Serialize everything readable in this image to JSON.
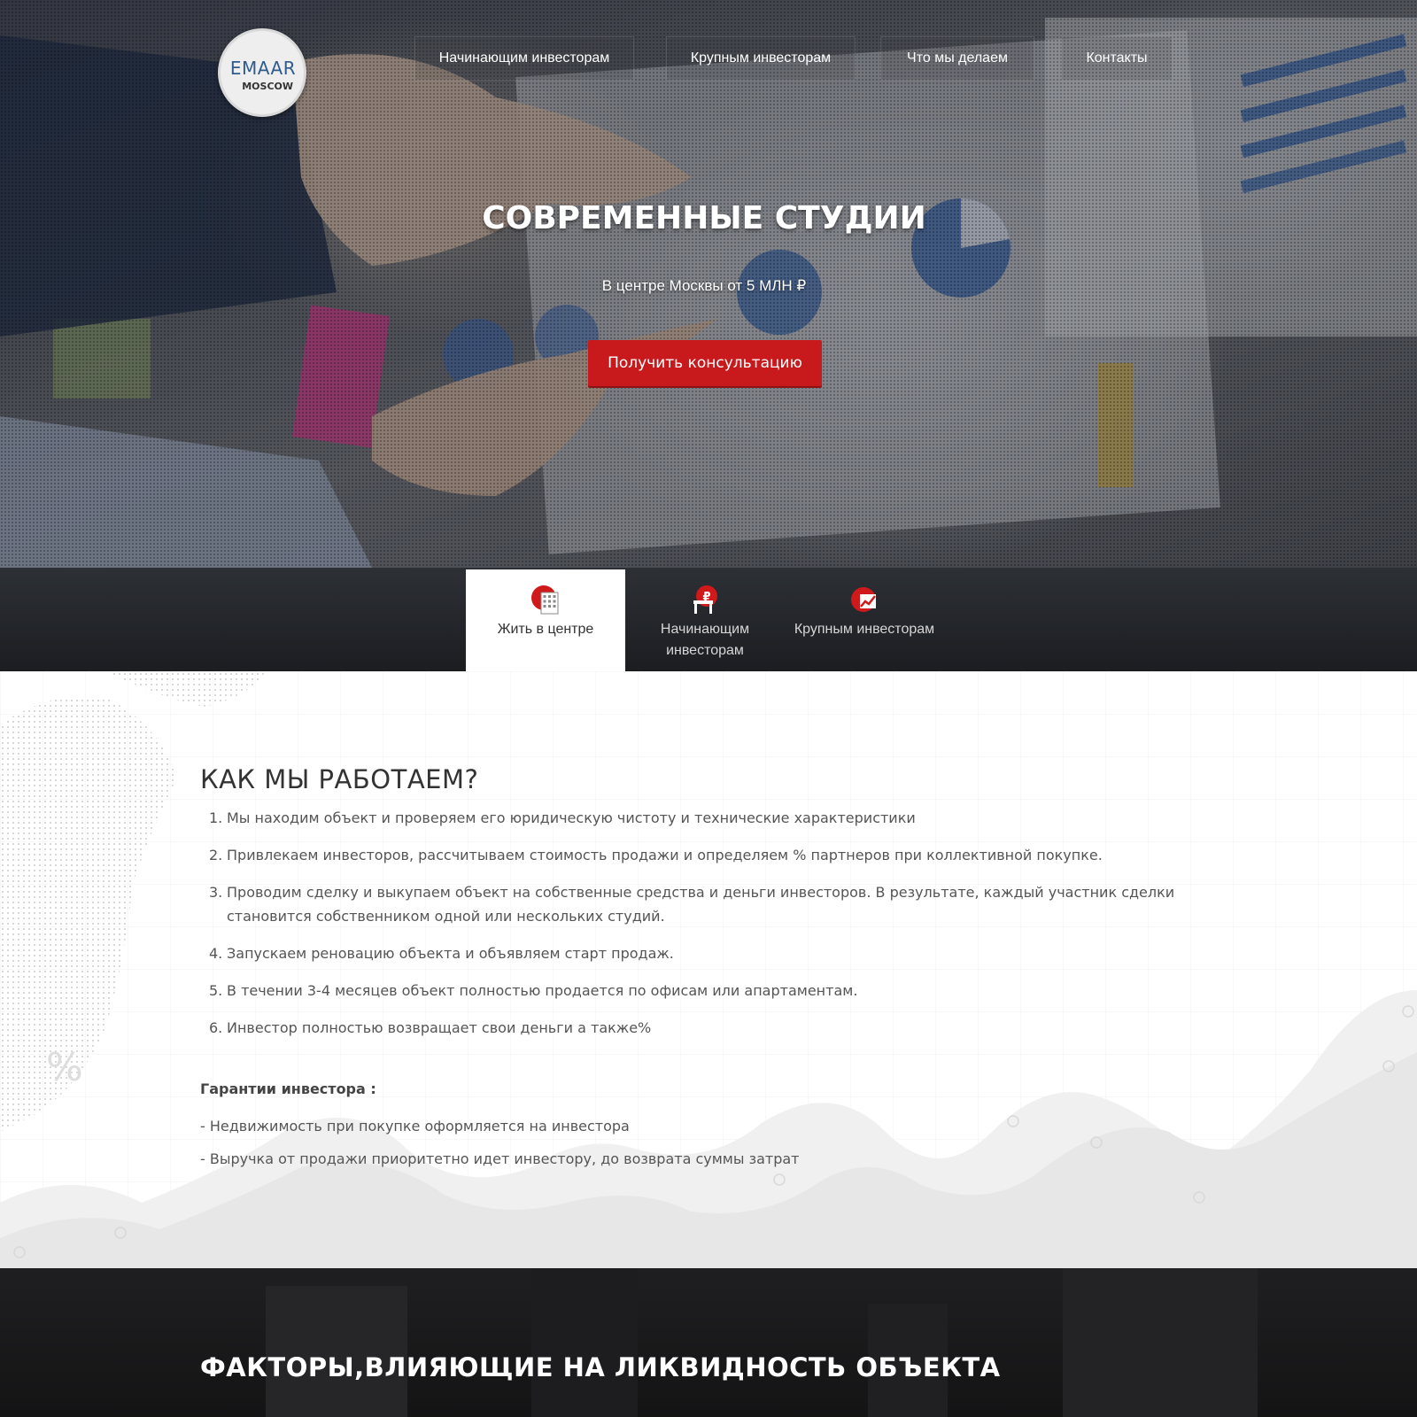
{
  "logo": {
    "main": "EMAAR",
    "sub": "MOSCOW"
  },
  "nav": [
    {
      "label": "Начинающим инвесторам"
    },
    {
      "label": "Крупным инвесторам"
    },
    {
      "label": "Что мы делаем"
    },
    {
      "label": "Контакты"
    }
  ],
  "hero": {
    "title": "СОВРЕМЕННЫЕ СТУДИИ",
    "subtitle": "В центре Москвы от 5 МЛН ₽",
    "cta_label": "Получить консультацию"
  },
  "tabs": [
    {
      "label": "Жить в центре",
      "icon": "building-icon",
      "active": true
    },
    {
      "label": "Начинающим инвесторам",
      "icon": "ruble-desk-icon",
      "active": false
    },
    {
      "label": "Крупным инвесторам",
      "icon": "growth-chart-icon",
      "active": false
    }
  ],
  "how_we_work": {
    "title": "КАК МЫ РАБОТАЕМ?",
    "steps": [
      {
        "num": "1.",
        "text": "Мы находим объект и проверяем его юридическую чистоту и технические характеристики"
      },
      {
        "num": "2.",
        "text": "Привлекаем инвесторов, рассчитываем стоимость продажи и определяем % партнеров при коллективной покупке."
      },
      {
        "num": "3.",
        "text": "Проводим сделку и выкупаем объект на собственные средства и деньги инвесторов. В результате, каждый участник сделки становится собственником одной или нескольких студий."
      },
      {
        "num": "4.",
        "text": "Запускаем реновацию объекта и объявляем старт продаж."
      },
      {
        "num": "5.",
        "text": "В течении 3-4 месяцев объект полностью продается по офисам или апартаментам."
      },
      {
        "num": "6.",
        "text": "Инвестор полностью возвращает свои деньги а также%"
      }
    ],
    "guarantees_title": "Гарантии инвестора :",
    "guarantees": [
      "- Недвижимость при покупке оформляется на инвестора",
      "- Выручка от продажи приоритетно идет инвестору, до возврата суммы затрат"
    ]
  },
  "factors": {
    "title": "ФАКТОРЫ,ВЛИЯЮЩИЕ НА ЛИКВИДНОСТЬ ОБЪЕКТА"
  },
  "colors": {
    "accent_red": "#c8191c",
    "logo_blue": "#2f5b8d",
    "tab_strip": "#23262a"
  }
}
